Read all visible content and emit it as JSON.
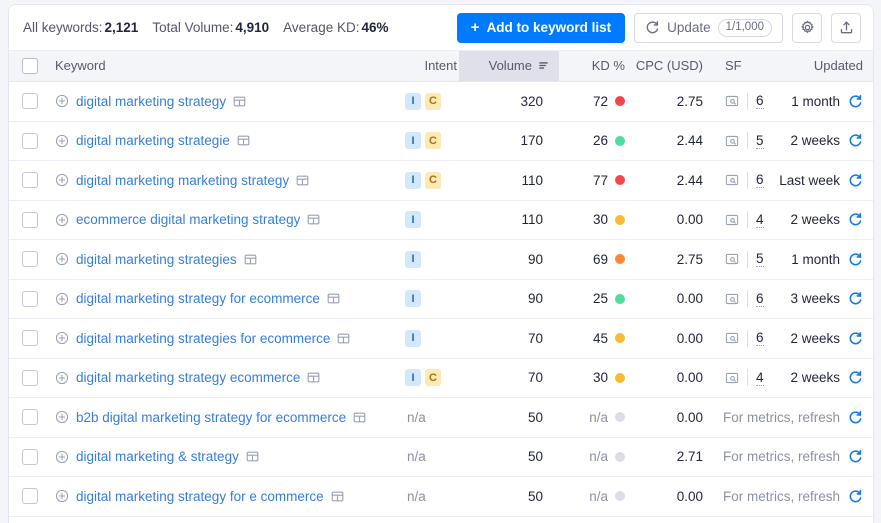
{
  "toolbar": {
    "stats": [
      {
        "label": "All keywords:",
        "value": "2,121"
      },
      {
        "label": "Total Volume:",
        "value": "4,910"
      },
      {
        "label": "Average KD:",
        "value": "46%"
      }
    ],
    "add_to_list_label": "Add to keyword list",
    "add_to_list_plus": "+",
    "update_label": "Update",
    "update_count": "1/1,000",
    "settings_icon": "gear-icon",
    "export_icon": "export-icon",
    "refresh_icon": "refresh-icon",
    "accent_color": "#007bff"
  },
  "table": {
    "columns": [
      {
        "key": "checkbox",
        "label": ""
      },
      {
        "key": "keyword",
        "label": "Keyword"
      },
      {
        "key": "intent",
        "label": "Intent"
      },
      {
        "key": "volume",
        "label": "Volume",
        "sorted": true,
        "sort_icon": "sort-desc-icon"
      },
      {
        "key": "kd",
        "label": "KD %"
      },
      {
        "key": "cpc",
        "label": "CPC (USD)"
      },
      {
        "key": "sf",
        "label": "SF"
      },
      {
        "key": "updated",
        "label": "Updated"
      }
    ],
    "na_label": "n/a",
    "refresh_prompt": "For metrics, refresh",
    "rows": [
      {
        "keyword": "digital marketing strategy",
        "intent": [
          "I",
          "C"
        ],
        "volume": "320",
        "kd": "72",
        "kd_color": "#f5454f",
        "cpc": "2.75",
        "sf": "6",
        "updated": "1 month"
      },
      {
        "keyword": "digital marketing strategie",
        "intent": [
          "I",
          "C"
        ],
        "volume": "170",
        "kd": "26",
        "kd_color": "#4fdda0",
        "cpc": "2.44",
        "sf": "5",
        "updated": "2 weeks"
      },
      {
        "keyword": "digital marketing marketing strategy",
        "intent": [
          "I",
          "C"
        ],
        "volume": "110",
        "kd": "77",
        "kd_color": "#f5454f",
        "cpc": "2.44",
        "sf": "6",
        "updated": "Last week"
      },
      {
        "keyword": "ecommerce digital marketing strategy",
        "intent": [
          "I"
        ],
        "volume": "110",
        "kd": "30",
        "kd_color": "#fbba33",
        "cpc": "0.00",
        "sf": "4",
        "updated": "2 weeks"
      },
      {
        "keyword": "digital marketing strategies",
        "intent": [
          "I"
        ],
        "volume": "90",
        "kd": "69",
        "kd_color": "#ff8636",
        "cpc": "2.75",
        "sf": "5",
        "updated": "1 month"
      },
      {
        "keyword": "digital marketing strategy for ecommerce",
        "intent": [
          "I"
        ],
        "volume": "90",
        "kd": "25",
        "kd_color": "#4fdda0",
        "cpc": "0.00",
        "sf": "6",
        "updated": "3 weeks"
      },
      {
        "keyword": "digital marketing strategies for ecommerce",
        "intent": [
          "I"
        ],
        "volume": "70",
        "kd": "45",
        "kd_color": "#fbba33",
        "cpc": "0.00",
        "sf": "6",
        "updated": "2 weeks"
      },
      {
        "keyword": "digital marketing strategy ecommerce",
        "intent": [
          "I",
          "C"
        ],
        "volume": "70",
        "kd": "30",
        "kd_color": "#fbba33",
        "cpc": "0.00",
        "sf": "4",
        "updated": "2 weeks"
      },
      {
        "keyword": "b2b digital marketing strategy for ecommerce",
        "intent": [],
        "intent_na": "n/a",
        "volume": "50",
        "kd": "n/a",
        "kd_color": "#dcdee6",
        "cpc": "0.00",
        "sf": "",
        "updated": "For metrics, refresh"
      },
      {
        "keyword": "digital marketing & strategy",
        "intent": [],
        "intent_na": "n/a",
        "volume": "50",
        "kd": "n/a",
        "kd_color": "#dcdee6",
        "cpc": "2.71",
        "sf": "",
        "updated": "For metrics, refresh"
      },
      {
        "keyword": "digital marketing strategy for e commerce",
        "intent": [],
        "intent_na": "n/a",
        "volume": "50",
        "kd": "n/a",
        "kd_color": "#dcdee6",
        "cpc": "0.00",
        "sf": "",
        "updated": "For metrics, refresh"
      }
    ]
  }
}
